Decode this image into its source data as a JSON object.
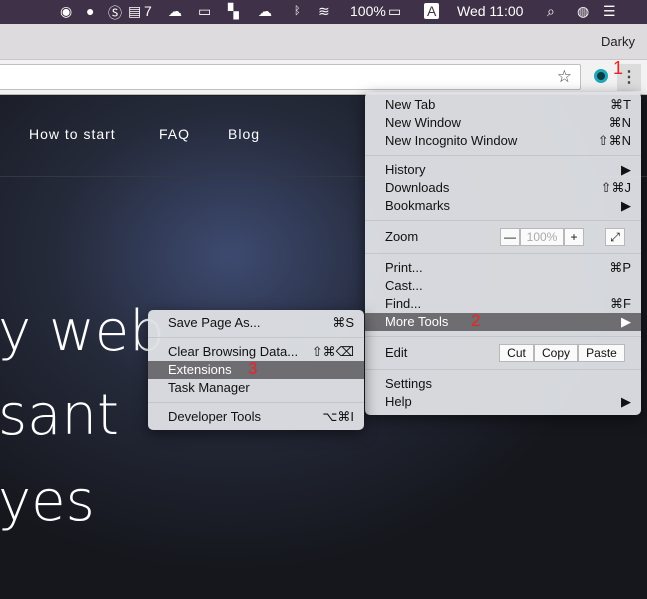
{
  "menubar": {
    "icons": [
      "viber-icon",
      "fantastical-icon",
      "skype-icon",
      "todoist-icon",
      "cloud-icon",
      "screen-icon",
      "layout-icon",
      "sync-icon",
      "bluetooth-icon",
      "wifi-icon"
    ],
    "todo_count": "7",
    "battery": "100%",
    "input_source": "A",
    "clock": "Wed 11:00"
  },
  "browser": {
    "profile": "Darky",
    "annotation_1": "1"
  },
  "page": {
    "nav": [
      "How to start",
      "FAQ",
      "Blog"
    ],
    "hero": [
      "y web",
      "sant",
      "yes"
    ]
  },
  "menu": {
    "new_tab": "New Tab",
    "new_tab_sc": "⌘T",
    "new_window": "New Window",
    "new_window_sc": "⌘N",
    "incognito": "New Incognito Window",
    "incognito_sc": "⇧⌘N",
    "history": "History",
    "downloads": "Downloads",
    "downloads_sc": "⇧⌘J",
    "bookmarks": "Bookmarks",
    "zoom": "Zoom",
    "zoom_minus": "—",
    "zoom_value": "100%",
    "zoom_plus": "+",
    "print": "Print...",
    "print_sc": "⌘P",
    "cast": "Cast...",
    "find": "Find...",
    "find_sc": "⌘F",
    "more_tools": "More Tools",
    "annotation_2": "2",
    "edit": "Edit",
    "cut": "Cut",
    "copy": "Copy",
    "paste": "Paste",
    "settings": "Settings",
    "help": "Help"
  },
  "submenu": {
    "save": "Save Page As...",
    "save_sc": "⌘S",
    "clear": "Clear Browsing Data...",
    "clear_sc": "⇧⌘⌫",
    "extensions": "Extensions",
    "annotation_3": "3",
    "task": "Task Manager",
    "dev": "Developer Tools",
    "dev_sc": "⌥⌘I"
  }
}
